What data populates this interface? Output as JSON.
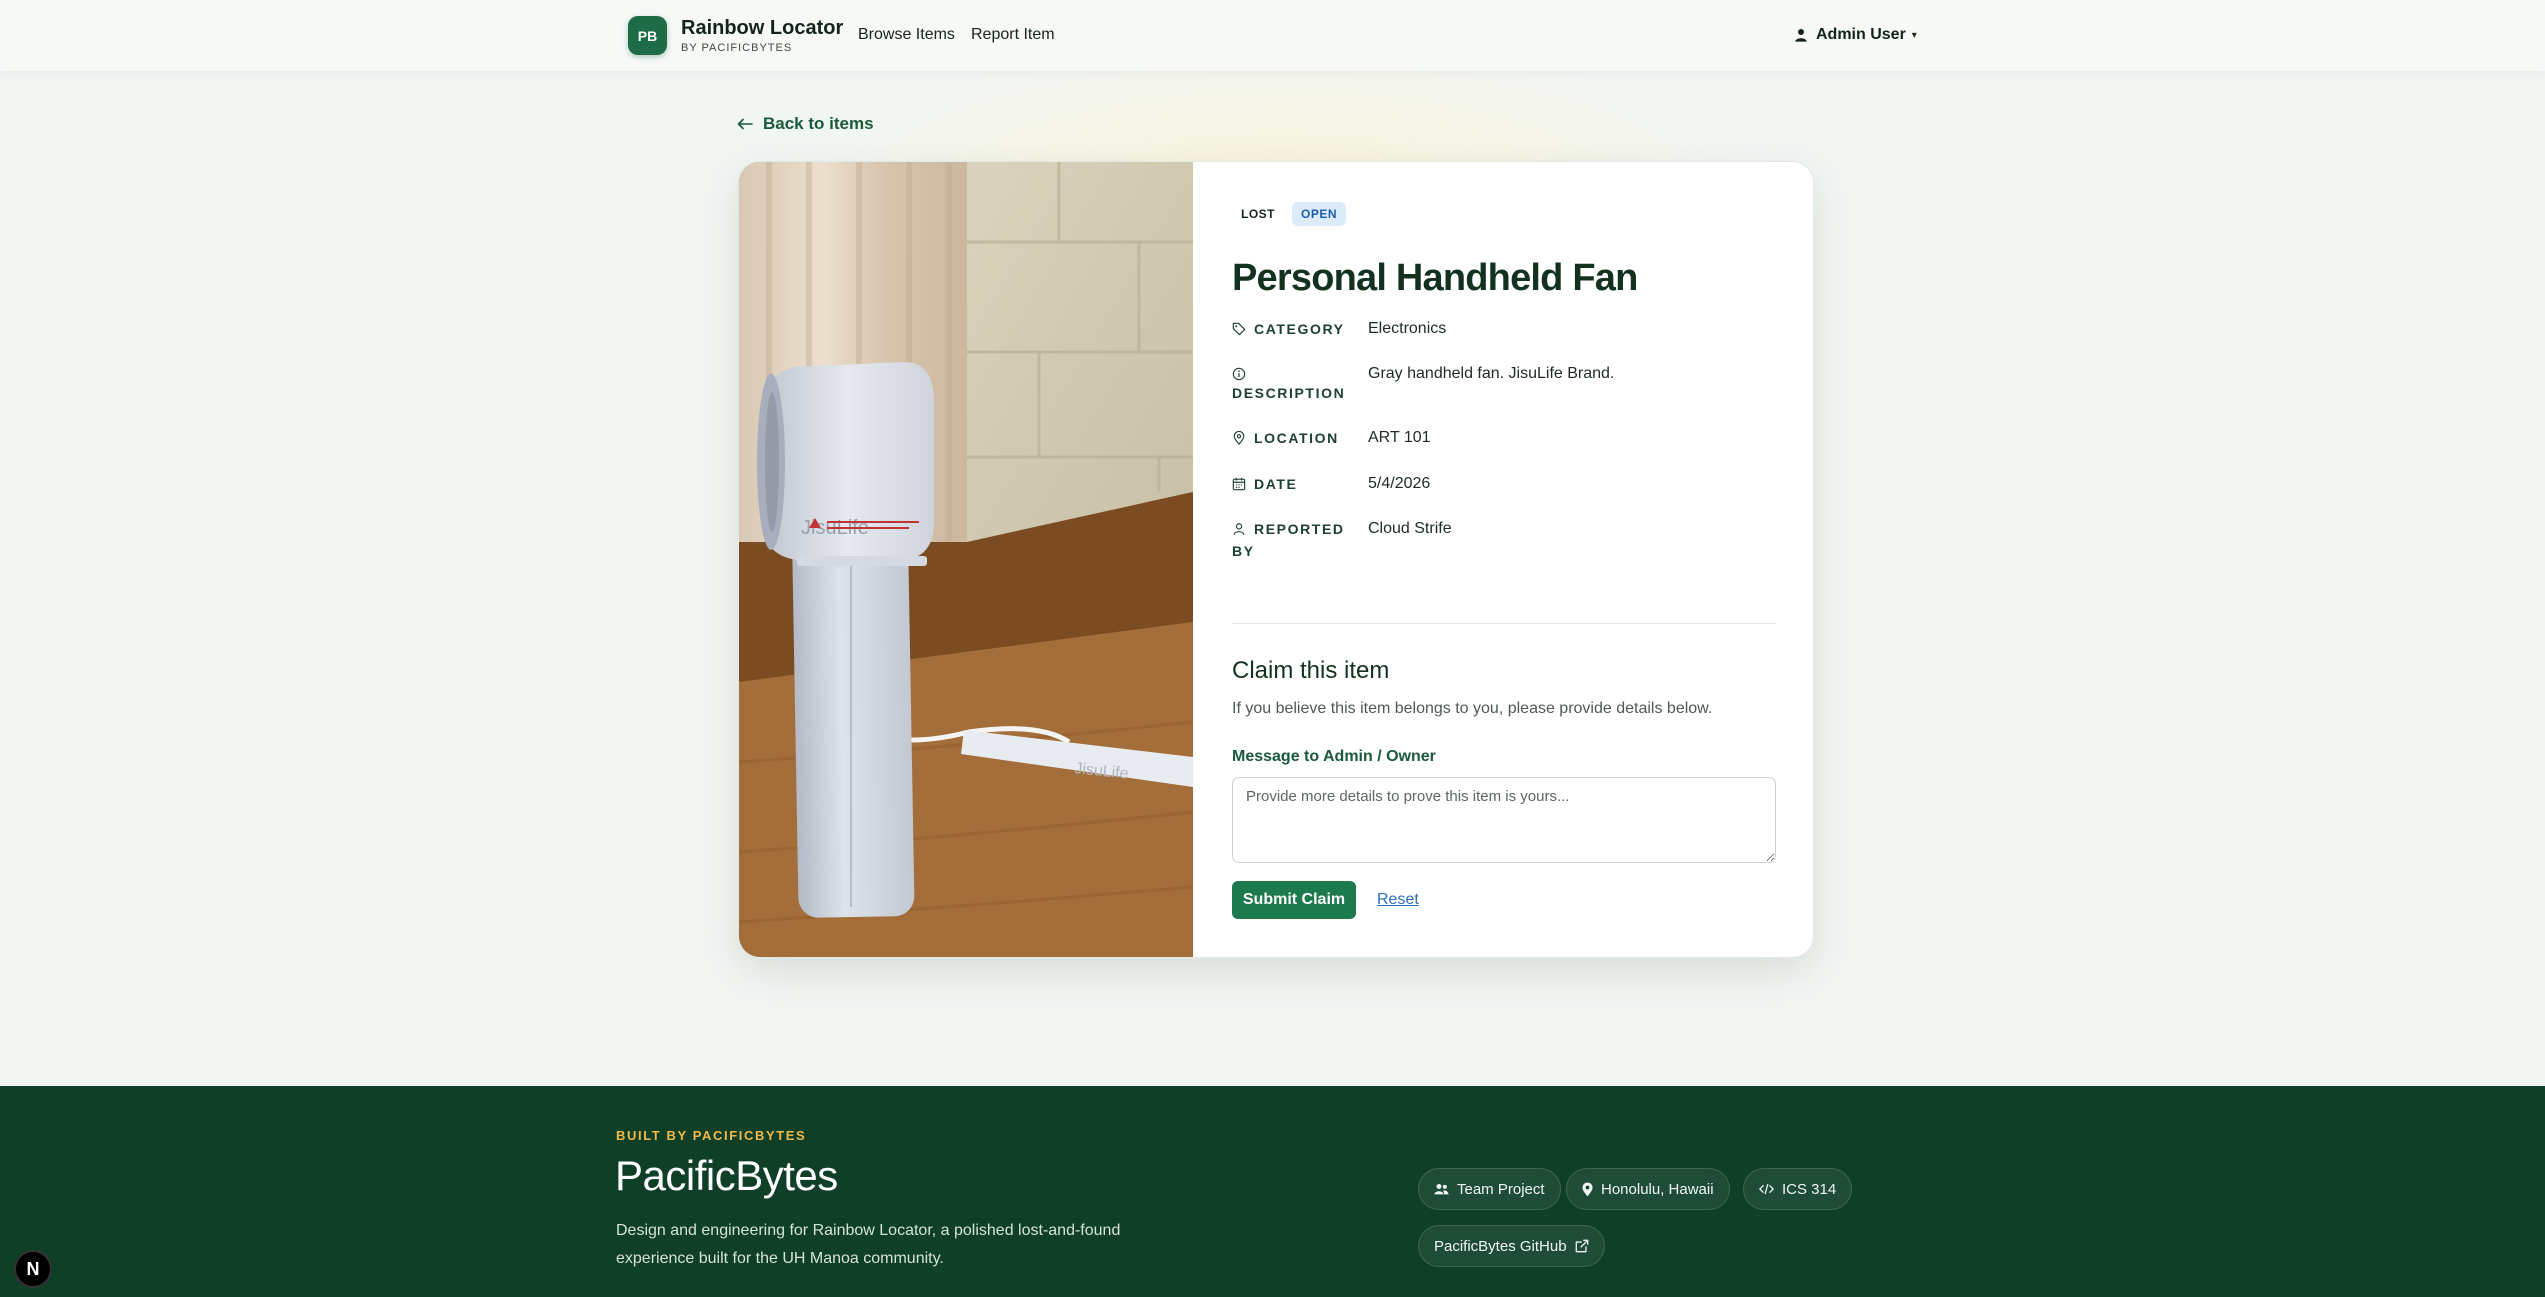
{
  "navbar": {
    "brand_badge": "PB",
    "brand_name": "Rainbow Locator",
    "brand_sub": "BY PACIFICBYTES",
    "links": [
      {
        "label": "Browse Items"
      },
      {
        "label": "Report Item"
      }
    ],
    "user_label": "Admin User"
  },
  "back_link": "Back to items",
  "item": {
    "chips": {
      "type": "LOST",
      "status": "OPEN"
    },
    "title": "Personal Handheld Fan",
    "details": {
      "category": {
        "label": "CATEGORY",
        "value": "Electronics"
      },
      "description": {
        "label": "DESCRIPTION",
        "value": "Gray handheld fan. JisuLife Brand."
      },
      "location": {
        "label": "LOCATION",
        "value": "ART 101"
      },
      "date": {
        "label": "DATE",
        "value": "5/4/2026"
      },
      "reported_by": {
        "label_1": "REPORTED",
        "label_2": "BY",
        "value": "Cloud Strife"
      }
    },
    "photo": {
      "brand_text": "JisuLife",
      "lanyard_text": "JisuLife"
    }
  },
  "claim": {
    "title": "Claim this item",
    "description": "If you believe this item belongs to you, please provide details below.",
    "message_label": "Message to Admin / Owner",
    "message_placeholder": "Provide more details to prove this item is yours...",
    "submit_label": "Submit Claim",
    "reset_label": "Reset"
  },
  "footer": {
    "kicker": "BUILT BY PACIFICBYTES",
    "title": "PacificBytes",
    "description": "Design and engineering for Rainbow Locator, a polished lost-and-found experience built for the UH Manoa community.",
    "chips": {
      "team": "Team Project",
      "location": "Honolulu, Hawaii",
      "course": "ICS 314",
      "github": "PacificBytes GitHub"
    }
  },
  "dev_badge": "N",
  "colors": {
    "brand_green": "#1d6b47",
    "button_green": "#1d7a4e",
    "footer_green": "#0f3f27",
    "footer_accent": "#f2b84a",
    "open_chip_bg": "#dcebfa",
    "open_chip_text": "#1d5ea8",
    "link_blue": "#2c6fbf"
  }
}
